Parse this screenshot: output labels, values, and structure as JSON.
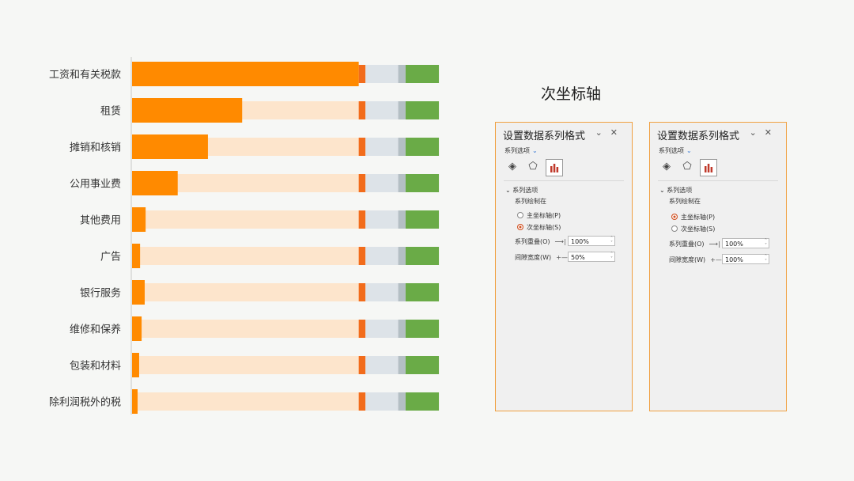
{
  "chart_data": {
    "type": "bar",
    "orientation": "horizontal",
    "categories": [
      "工资和有关税款",
      "租赁",
      "摊销和核销",
      "公用事业费",
      "其他费用",
      "广告",
      "银行服务",
      "维修和保养",
      "包装和材料",
      "除利润税外的税"
    ],
    "series": [
      {
        "values": [
          0.735,
          0.357,
          0.246,
          0.148,
          0.044,
          0.026,
          0.041,
          0.031,
          0.023,
          0.018
        ]
      },
      {
        "values": [
          0.735,
          0.735,
          0.735,
          0.735,
          0.735,
          0.735,
          0.735,
          0.735,
          0.735,
          0.735
        ]
      },
      {
        "values": [
          0.022,
          0.022,
          0.022,
          0.022,
          0.022,
          0.022,
          0.022,
          0.022,
          0.022,
          0.022
        ]
      },
      {
        "values": [
          0.106,
          0.106,
          0.106,
          0.106,
          0.106,
          0.106,
          0.106,
          0.106,
          0.106,
          0.106
        ]
      },
      {
        "values": [
          0.024,
          0.024,
          0.024,
          0.024,
          0.024,
          0.024,
          0.024,
          0.024,
          0.024,
          0.024
        ]
      },
      {
        "values": [
          0.108,
          0.108,
          0.108,
          0.108,
          0.108,
          0.108,
          0.108,
          0.108,
          0.108,
          0.108
        ]
      }
    ],
    "colors": [
      "#ff8a00",
      "#fde5cc",
      "#f26c1b",
      "#dde3e8",
      "#b4bfc4",
      "#6aab47"
    ],
    "xlim": [
      0,
      1
    ]
  },
  "right_title": "次坐标轴",
  "panels": [
    {
      "title": "设置数据系列格式",
      "options_label": "系列选项",
      "section_label": "系列选项",
      "plot_on_label": "系列绘制在",
      "radio_primary": "主坐标轴(P)",
      "radio_secondary": "次坐标轴(S)",
      "overlap_label": "系列重叠(O)",
      "overlap_value": "100%",
      "gap_label": "间隙宽度(W)",
      "gap_value": "50%"
    },
    {
      "title": "设置数据系列格式",
      "options_label": "系列选项",
      "section_label": "系列选项",
      "plot_on_label": "系列绘制在",
      "radio_primary": "主坐标轴(P)",
      "radio_secondary": "次坐标轴(S)",
      "overlap_label": "系列重叠(O)",
      "overlap_value": "100%",
      "gap_label": "间隙宽度(W)",
      "gap_value": "100%"
    }
  ],
  "icons": {
    "fill": "paint-bucket-icon",
    "effects": "pentagon-icon",
    "options": "bar-chart-icon",
    "collapse": "chevron-down-icon",
    "close": "close-icon"
  }
}
